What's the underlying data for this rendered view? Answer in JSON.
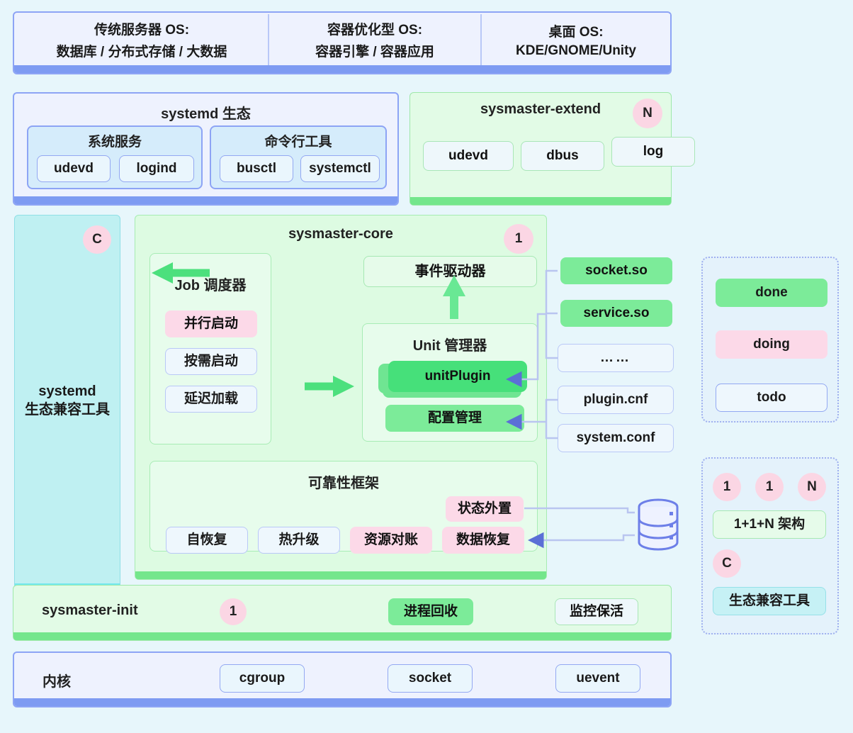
{
  "os_layer": {
    "items": [
      {
        "line1": "传统服务器 OS:",
        "line2": "数据库 / 分布式存储 / 大数据"
      },
      {
        "line1": "容器优化型 OS:",
        "line2": "容器引擎 / 容器应用"
      },
      {
        "line1": "桌面 OS:",
        "line2": "KDE/GNOME/Unity"
      }
    ]
  },
  "systemd_eco": {
    "title": "systemd 生态",
    "groups": [
      {
        "title": "系统服务",
        "items": [
          "udevd",
          "logind"
        ]
      },
      {
        "title": "命令行工具",
        "items": [
          "busctl",
          "systemctl"
        ]
      }
    ]
  },
  "sysmaster_extend": {
    "title": "sysmaster-extend",
    "badge": "N",
    "items": [
      "udevd",
      "dbus",
      "log"
    ]
  },
  "compat_tool": {
    "badge": "C",
    "line1": "systemd",
    "line2": "生态兼容工具"
  },
  "core": {
    "title": "sysmaster-core",
    "badge": "1",
    "job_scheduler": {
      "title": "Job 调度器",
      "items": [
        {
          "label": "并行启动",
          "status": "doing"
        },
        {
          "label": "按需启动",
          "status": "todo"
        },
        {
          "label": "延迟加载",
          "status": "todo"
        }
      ]
    },
    "event_driver": "事件驱动器",
    "unit_manager": {
      "title": "Unit 管理器",
      "unit_plugin": "unitPlugin",
      "config_manager": "配置管理"
    },
    "reliability": {
      "title": "可靠性框架",
      "state_external": {
        "label": "状态外置",
        "status": "doing"
      },
      "items": [
        {
          "label": "自恢复",
          "status": "todo"
        },
        {
          "label": "热升级",
          "status": "todo"
        },
        {
          "label": "资源对账",
          "status": "doing"
        },
        {
          "label": "数据恢复",
          "status": "doing"
        }
      ]
    }
  },
  "plugins": {
    "items": [
      {
        "label": "socket.so",
        "status": "done"
      },
      {
        "label": "service.so",
        "status": "done"
      },
      {
        "label": "……",
        "status": "todo"
      },
      {
        "label": "plugin.cnf",
        "status": "todo"
      },
      {
        "label": "system.conf",
        "status": "todo"
      }
    ]
  },
  "legend_status": {
    "items": [
      {
        "label": "done",
        "color": "#7ceb99"
      },
      {
        "label": "doing",
        "color": "#fcd9e8"
      },
      {
        "label": "todo",
        "color": "#eef7fd"
      }
    ]
  },
  "legend_arch": {
    "badges": [
      "1",
      "1",
      "N"
    ],
    "arch_label": "1+1+N 架构",
    "compat_badge": "C",
    "compat_label": "生态兼容工具"
  },
  "sysmaster_init": {
    "title": "sysmaster-init",
    "badge": "1",
    "items": [
      {
        "label": "进程回收",
        "status": "done"
      },
      {
        "label": "监控保活",
        "status": "todo"
      }
    ]
  },
  "kernel": {
    "title": "内核",
    "items": [
      "cgroup",
      "socket",
      "uevent"
    ]
  },
  "database_icon": "database-icon"
}
